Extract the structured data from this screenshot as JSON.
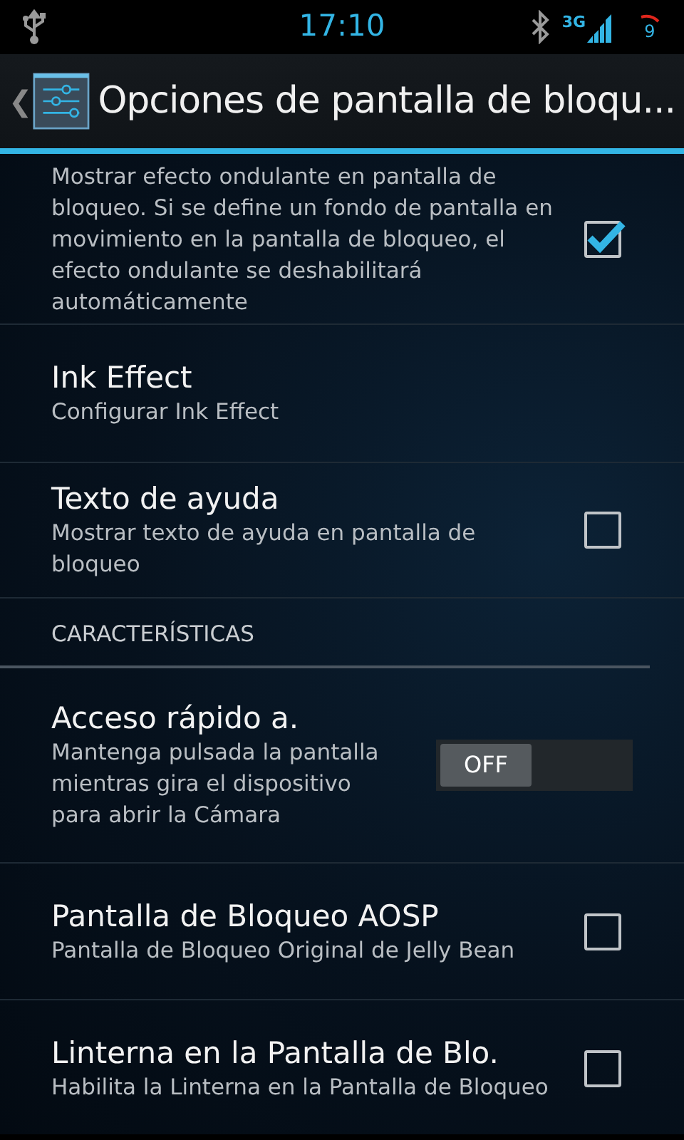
{
  "status_bar": {
    "time": "17:10",
    "network": "3G",
    "battery": "9"
  },
  "action_bar": {
    "back": "❮",
    "title": "Opciones de pantalla de bloqu..."
  },
  "items": [
    {
      "kind": "checkbox",
      "summary": "Mostrar efecto ondulante en pantalla de bloqueo. Si se define un fondo de pantalla en movimiento en la pantalla de bloqueo, el efecto ondulante se deshabilitará automáticamente",
      "checked": true
    },
    {
      "kind": "plain",
      "title": "Ink Effect",
      "summary": "Configurar Ink Effect"
    },
    {
      "kind": "checkbox",
      "title": "Texto de ayuda",
      "summary": "Mostrar texto de ayuda en pantalla de bloqueo",
      "checked": false
    },
    {
      "kind": "header",
      "title": "CARACTERÍSTICAS"
    },
    {
      "kind": "toggle",
      "title": "Acceso rápido a.",
      "summary": "Mantenga pulsada la pantalla mientras gira el dispositivo para abrir la Cámara",
      "on": false,
      "label": "OFF"
    },
    {
      "kind": "checkbox",
      "title": "Pantalla de Bloqueo AOSP",
      "summary": "Pantalla de Bloqueo Original de Jelly Bean",
      "checked": false
    },
    {
      "kind": "checkbox",
      "title": "Linterna en la Pantalla de Blo.",
      "summary": "Habilita la Linterna en la Pantalla de Bloqueo",
      "checked": false
    }
  ]
}
